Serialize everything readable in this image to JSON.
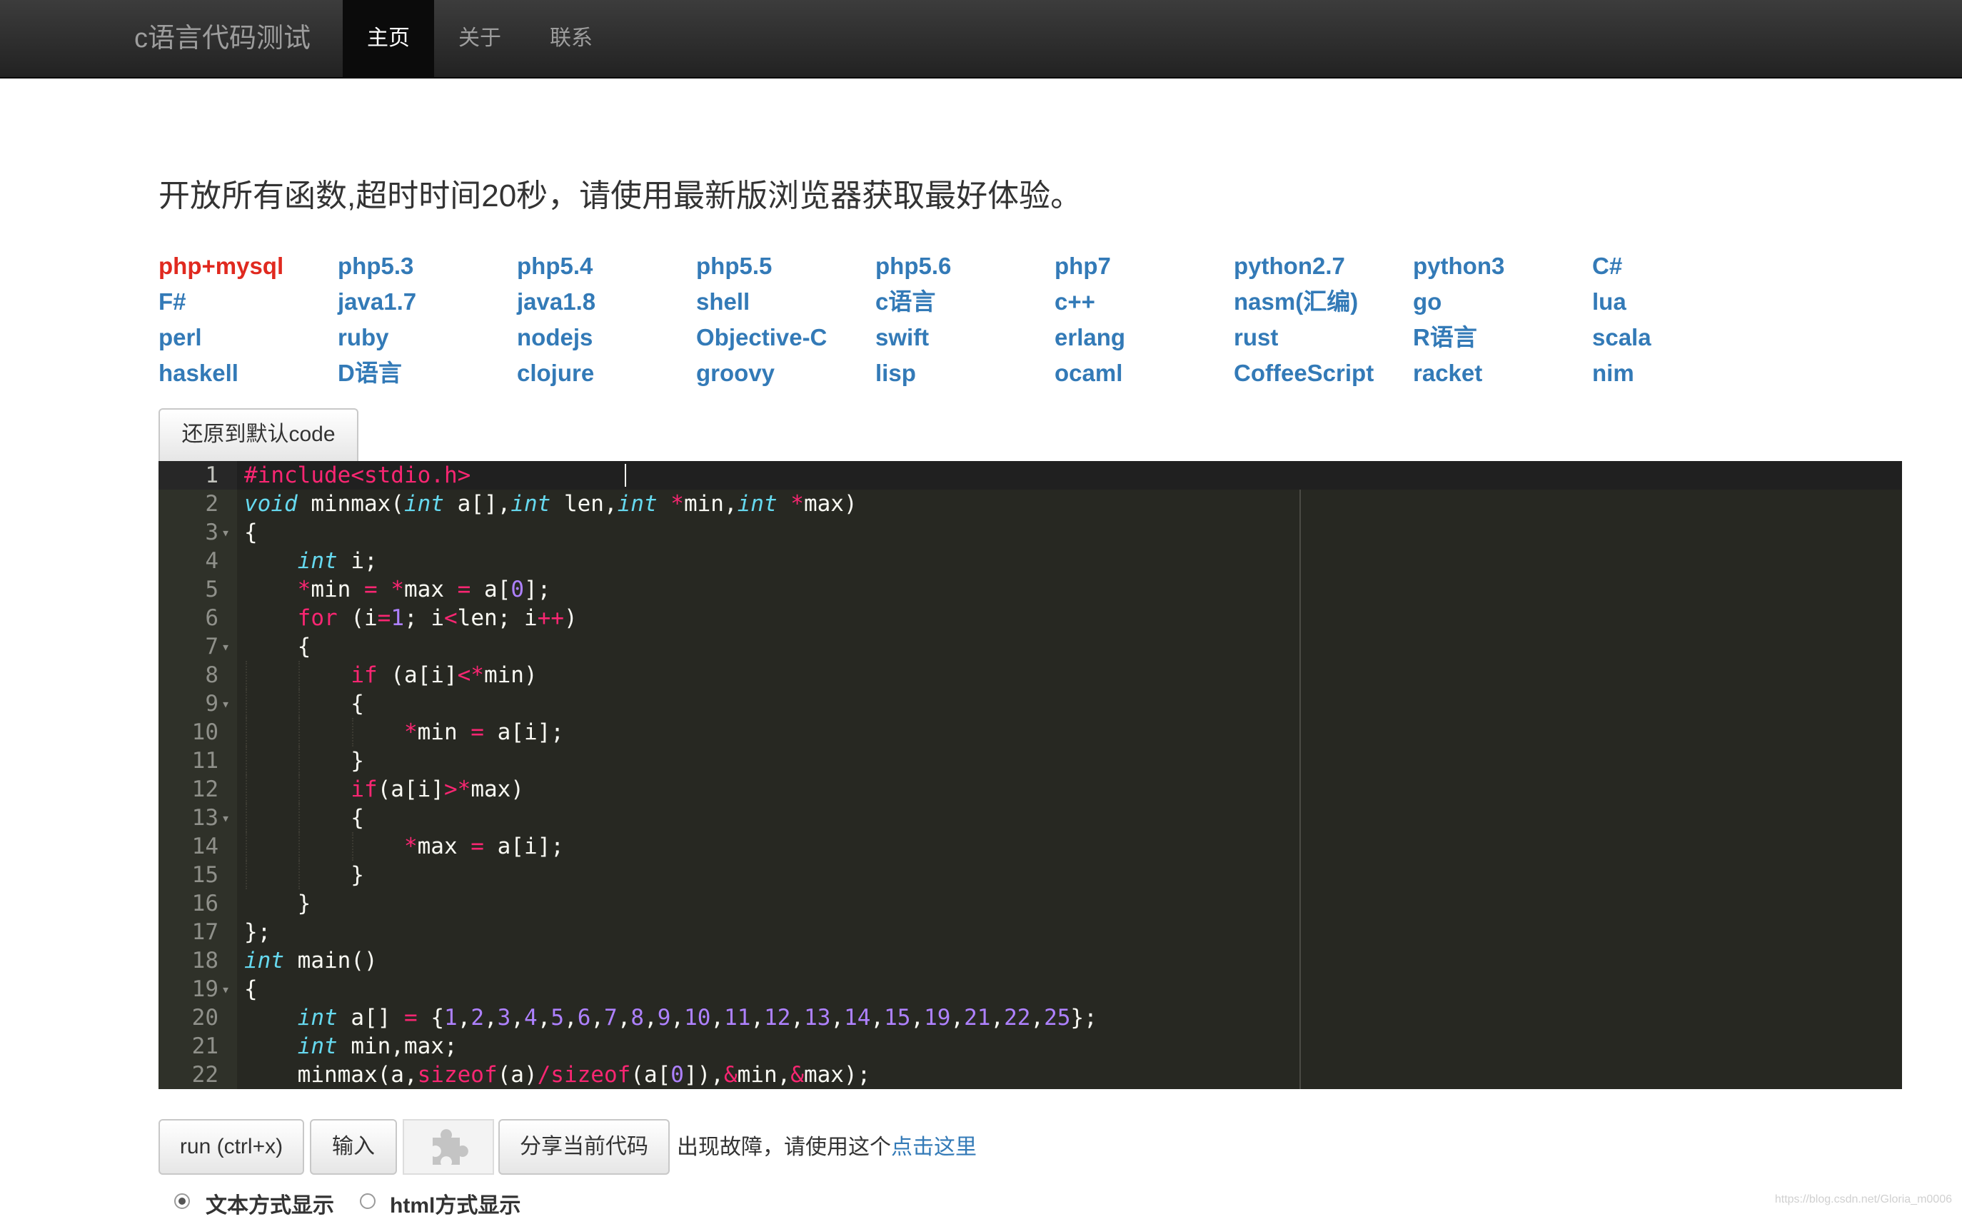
{
  "navbar": {
    "brand": "c语言代码测试",
    "items": [
      "主页",
      "关于",
      "联系"
    ],
    "active": 0
  },
  "lead": "开放所有函数,超时时间20秒，请使用最新版浏览器获取最好体验。",
  "languages": {
    "current": "php+mysql",
    "rows": [
      [
        "php+mysql",
        "php5.3",
        "php5.4",
        "php5.5",
        "php5.6",
        "php7",
        "python2.7",
        "python3",
        "C#"
      ],
      [
        "F#",
        "java1.7",
        "java1.8",
        "shell",
        "c语言",
        "c++",
        "nasm(汇编)",
        "go",
        "lua"
      ],
      [
        "perl",
        "ruby",
        "nodejs",
        "Objective-C",
        "swift",
        "erlang",
        "rust",
        "R语言",
        "scala"
      ],
      [
        "haskell",
        "D语言",
        "clojure",
        "groovy",
        "lisp",
        "ocaml",
        "CoffeeScript",
        "racket",
        "nim"
      ]
    ]
  },
  "restore_button": "还原到默认code",
  "editor": {
    "fold_lines": [
      3,
      7,
      9,
      13,
      19
    ],
    "lines": [
      "#include<stdio.h>",
      "void minmax(int a[],int len,int *min,int *max)",
      "{",
      "    int i;",
      "    *min = *max = a[0];",
      "    for (i=1; i<len; i++)",
      "    {",
      "        if (a[i]<*min)",
      "        {",
      "            *min = a[i];",
      "        }",
      "        if(a[i]>*max)",
      "        {",
      "            *max = a[i];",
      "        }",
      "    }",
      "};",
      "int main()",
      "{",
      "    int a[] = {1,2,3,4,5,6,7,8,9,10,11,12,13,14,15,19,21,22,25};",
      "    int min,max;",
      "    minmax(a,sizeof(a)/sizeof(a[0]),&min,&max);"
    ]
  },
  "bottom": {
    "run_button": "run (ctrl+x)",
    "input_button": "输入",
    "plugin_icon": "puzzle-piece-icon",
    "share_button": "分享当前代码",
    "note_text": "出现故障，请使用这个",
    "note_link": "点击这里",
    "radio_text": "文本方式显示",
    "radio_html": "html方式显示",
    "selected_mode": "text"
  },
  "watermark": "https://blog.csdn.net/Gloria_m0006"
}
